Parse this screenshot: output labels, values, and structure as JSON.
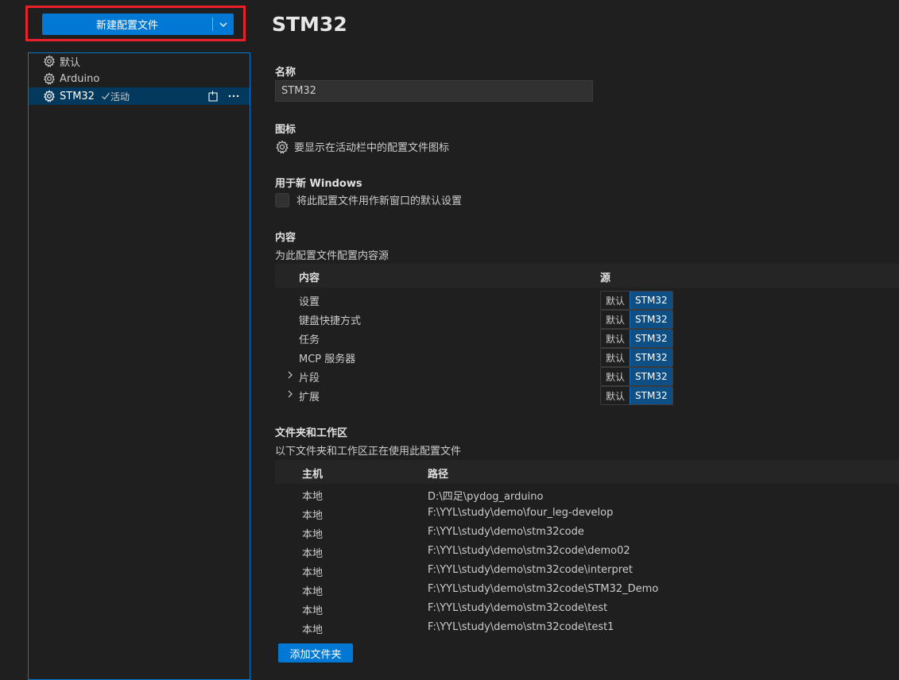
{
  "sidebar": {
    "new_profile_label": "新建配置文件",
    "profiles": [
      {
        "label": "默认",
        "active": false
      },
      {
        "label": "Arduino",
        "active": false
      },
      {
        "label": "STM32",
        "active": true,
        "active_label": "活动"
      }
    ]
  },
  "main": {
    "title": "STM32",
    "name_label": "名称",
    "name_value": "STM32",
    "icon_label": "图标",
    "icon_desc": "要显示在活动栏中的配置文件图标",
    "new_windows_label": "用于新 Windows",
    "new_windows_checkbox_label": "将此配置文件用作新窗口的默认设置",
    "new_windows_checked": false,
    "contents_label": "内容",
    "contents_desc": "为此配置文件配置内容源",
    "contents_header": {
      "content": "内容",
      "source": "源"
    },
    "contents": [
      {
        "name": "设置",
        "expandable": false,
        "options": [
          "默认",
          "STM32"
        ],
        "selected": "STM32"
      },
      {
        "name": "键盘快捷方式",
        "expandable": false,
        "options": [
          "默认",
          "STM32"
        ],
        "selected": "STM32"
      },
      {
        "name": "任务",
        "expandable": false,
        "options": [
          "默认",
          "STM32"
        ],
        "selected": "STM32"
      },
      {
        "name": "MCP 服务器",
        "expandable": false,
        "options": [
          "默认",
          "STM32"
        ],
        "selected": "STM32"
      },
      {
        "name": "片段",
        "expandable": true,
        "options": [
          "默认",
          "STM32"
        ],
        "selected": "STM32"
      },
      {
        "name": "扩展",
        "expandable": true,
        "options": [
          "默认",
          "STM32"
        ],
        "selected": "STM32"
      }
    ],
    "folders_label": "文件夹和工作区",
    "folders_desc": "以下文件夹和工作区正在使用此配置文件",
    "folders_header": {
      "host": "主机",
      "path": "路径"
    },
    "folders": [
      {
        "host": "本地",
        "path": "D:\\四足\\pydog_arduino"
      },
      {
        "host": "本地",
        "path": "F:\\YYL\\study\\demo\\four_leg-develop"
      },
      {
        "host": "本地",
        "path": "F:\\YYL\\study\\demo\\stm32code"
      },
      {
        "host": "本地",
        "path": "F:\\YYL\\study\\demo\\stm32code\\demo02"
      },
      {
        "host": "本地",
        "path": "F:\\YYL\\study\\demo\\stm32code\\interpret"
      },
      {
        "host": "本地",
        "path": "F:\\YYL\\study\\demo\\stm32code\\STM32_Demo"
      },
      {
        "host": "本地",
        "path": "F:\\YYL\\study\\demo\\stm32code\\test"
      },
      {
        "host": "本地",
        "path": "F:\\YYL\\study\\demo\\stm32code\\test1"
      }
    ],
    "add_folder_label": "添加文件夹"
  },
  "colors": {
    "accent": "#0078d4",
    "highlight": "#e8202a",
    "selected_row": "#04395e",
    "background": "#1f1f1f"
  },
  "icons": [
    "gear-icon",
    "chevron-down-icon",
    "check-icon",
    "new-window-icon",
    "more-icon",
    "chevron-right-icon"
  ]
}
